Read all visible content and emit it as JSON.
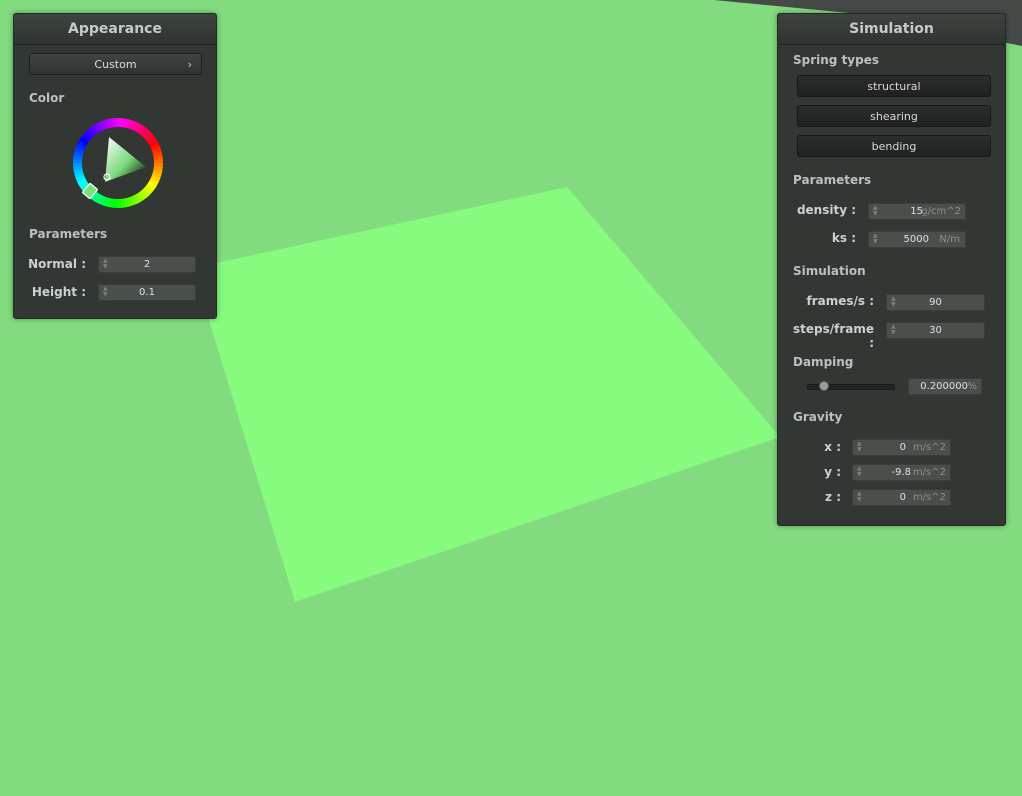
{
  "colors": {
    "background": "#82db7f",
    "cloth": "#86fb7e",
    "panel": "#323734"
  },
  "appearance": {
    "title": "Appearance",
    "preset": "Custom",
    "color_label": "Color",
    "parameters_label": "Parameters",
    "normal_label": "Normal :",
    "normal_value": "2",
    "height_label": "Height :",
    "height_value": "0.1"
  },
  "simulation": {
    "title": "Simulation",
    "spring_types_label": "Spring types",
    "spring_buttons": [
      "structural",
      "shearing",
      "bending"
    ],
    "parameters_label": "Parameters",
    "density_label": "density :",
    "density_value": "15",
    "density_unit": "g/cm^2",
    "ks_label": "ks :",
    "ks_value": "5000",
    "ks_unit": "N/m",
    "simulation_label": "Simulation",
    "fps_label": "frames/s :",
    "fps_value": "90",
    "steps_label": "steps/frame :",
    "steps_value": "30",
    "damping_label": "Damping",
    "damping_value": "0.200000",
    "damping_unit": "%",
    "damping_fraction": 0.2,
    "gravity_label": "Gravity",
    "gx_label": "x :",
    "gx_value": "0",
    "gy_label": "y :",
    "gy_value": "-9.8",
    "gz_label": "z :",
    "gz_value": "0",
    "gravity_unit": "m/s^2"
  }
}
